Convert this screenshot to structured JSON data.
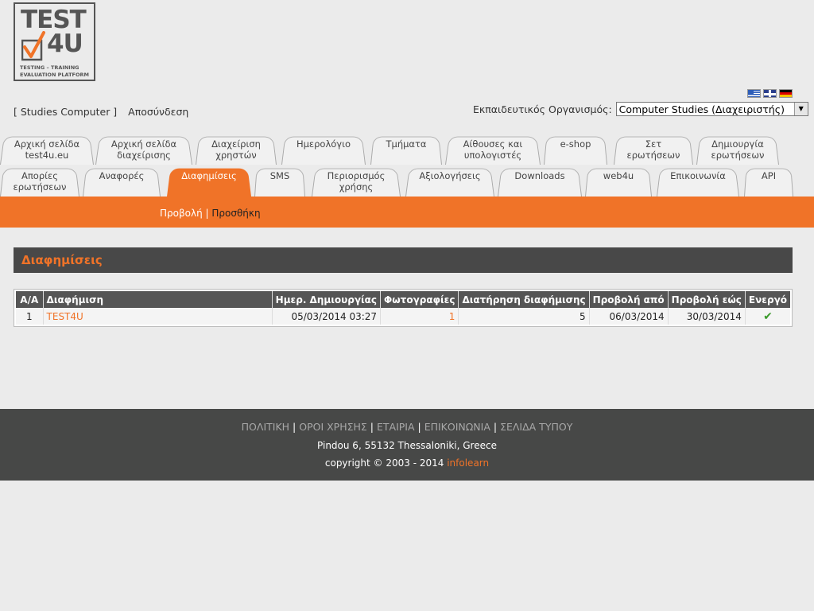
{
  "logo": {
    "line1": "TEST",
    "line2": "4U",
    "line3": "TESTING  –  TRAINING",
    "line4": "EVALUATION PLATFORM"
  },
  "flags": [
    "greek-flag-icon",
    "english-flag-icon",
    "german-flag-icon"
  ],
  "user": {
    "account": "[ Studies Computer ]",
    "logout": "Αποσύνδεση"
  },
  "org": {
    "label": "Εκπαιδευτικός Οργανισμός:",
    "selected": "Computer Studies (Διαχειριστής)"
  },
  "tabs_row1": [
    "Αρχική σελίδα\ntest4u.eu",
    "Αρχική σελίδα\nδιαχείρισης",
    "Διαχείριση\nχρηστών",
    "Ημερολόγιο",
    "Τμήματα",
    "Αίθουσες και\nυπολογιστές",
    "e-shop",
    "Σετ\nερωτήσεων",
    "Δημιουργία\nερωτήσεων"
  ],
  "tabs_row2": [
    "Απορίες\nερωτήσεων",
    "Αναφορές",
    "Διαφημίσεις",
    "SMS",
    "Περιορισμός\nχρήσης",
    "Αξιολογήσεις",
    "Downloads",
    "web4u",
    "Επικοινωνία",
    "API"
  ],
  "subnav": {
    "view": "Προβολή",
    "sep": " | ",
    "add": "Προσθήκη"
  },
  "section_title": "Διαφημίσεις",
  "table": {
    "headers": [
      "Α/Α",
      "Διαφήμιση",
      "Ημερ. Δημιουργίας",
      "Φωτογραφίες",
      "Διατήρηση διαφήμισης",
      "Προβολή από",
      "Προβολή εώς",
      "Ενεργό"
    ],
    "rows": [
      [
        "1",
        "TEST4U",
        "05/03/2014 03:27",
        "1",
        "5",
        "06/03/2014",
        "30/03/2014",
        "✔"
      ]
    ]
  },
  "footer": {
    "links": [
      "ΠΟΛΙΤΙΚΗ",
      "ΟΡΟΙ ΧΡΗΣΗΣ",
      "ΕΤΑΙΡΙΑ",
      "ΕΠΙΚΟΙΝΩΝΙΑ",
      "ΣΕΛΙΔΑ ΤΥΠΟΥ"
    ],
    "address": "Pindou 6, 55132 Thessaloniki, Greece",
    "copyright": "copyright © 2003 - 2014 ",
    "company": "infolearn"
  }
}
